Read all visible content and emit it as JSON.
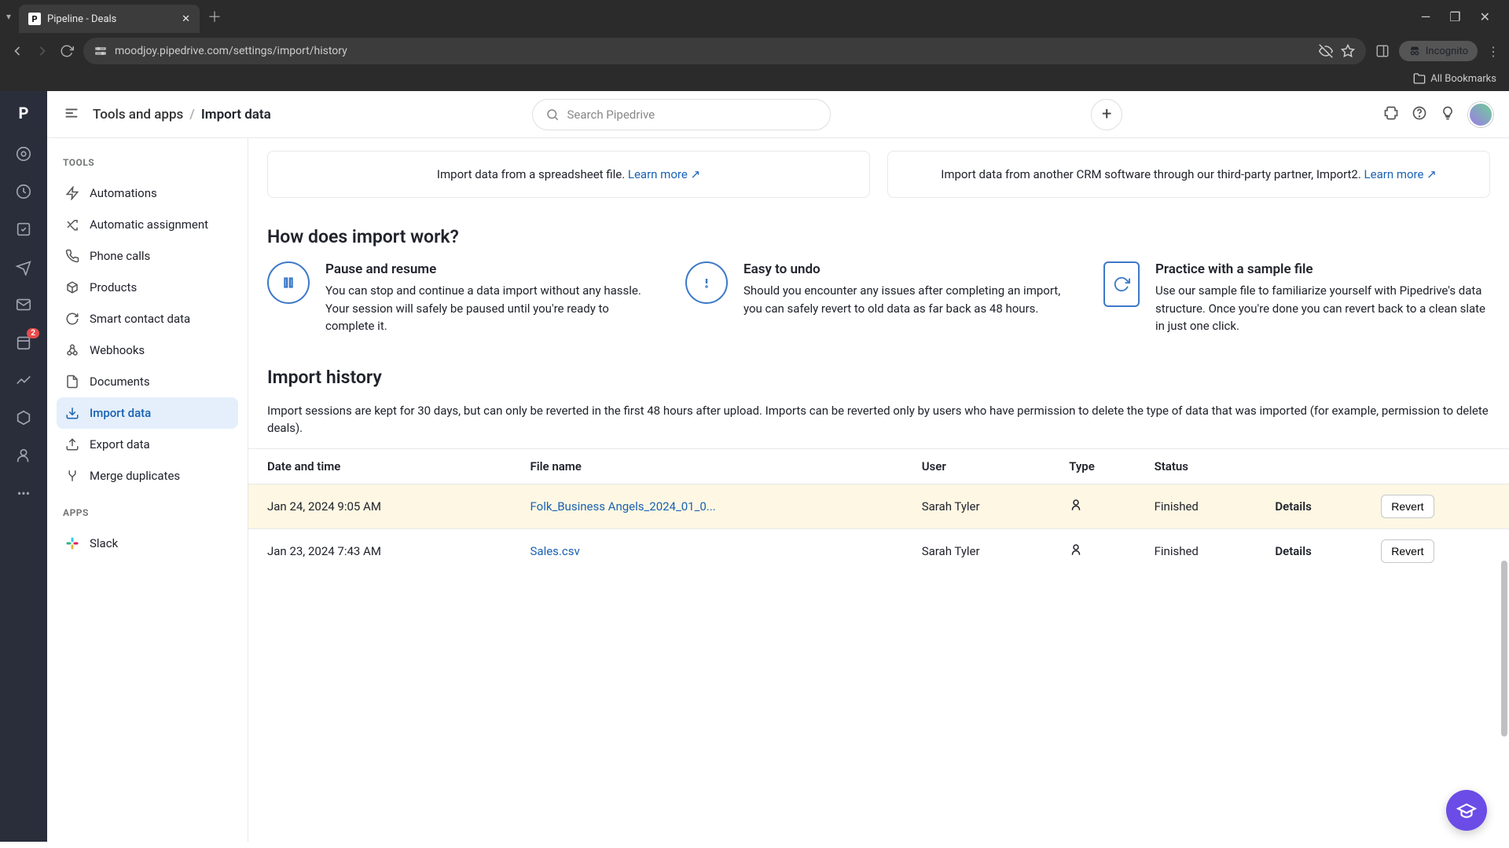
{
  "browser": {
    "tab_title": "Pipeline - Deals",
    "url": "moodjoy.pipedrive.com/settings/import/history",
    "incognito": "Incognito",
    "all_bookmarks": "All Bookmarks"
  },
  "header": {
    "breadcrumb_root": "Tools and apps",
    "breadcrumb_current": "Import data",
    "search_placeholder": "Search Pipedrive"
  },
  "sidebar": {
    "section_tools": "TOOLS",
    "section_apps": "APPS",
    "items": [
      {
        "label": "Automations"
      },
      {
        "label": "Automatic assignment"
      },
      {
        "label": "Phone calls"
      },
      {
        "label": "Products"
      },
      {
        "label": "Smart contact data"
      },
      {
        "label": "Webhooks"
      },
      {
        "label": "Documents"
      },
      {
        "label": "Import data"
      },
      {
        "label": "Export data"
      },
      {
        "label": "Merge duplicates"
      }
    ],
    "apps": [
      {
        "label": "Slack"
      }
    ]
  },
  "nav_badge": "2",
  "cards": {
    "spreadsheet": {
      "text": "Import data from a spreadsheet file.",
      "link": "Learn more"
    },
    "crm": {
      "text": "Import data from another CRM software through our third-party partner, Import2.",
      "link": "Learn more"
    }
  },
  "section_title": "How does import work?",
  "features": [
    {
      "title": "Pause and resume",
      "desc": "You can stop and continue a data import without any hassle. Your session will safely be paused until you're ready to complete it."
    },
    {
      "title": "Easy to undo",
      "desc": "Should you encounter any issues after completing an import, you can safely revert to old data as far back as 48 hours."
    },
    {
      "title": "Practice with a sample file",
      "desc": "Use our sample file to familiarize yourself with Pipedrive's data structure. Once you're done you can revert back to a clean slate in just one click."
    }
  ],
  "history": {
    "title": "Import history",
    "desc": "Import sessions are kept for 30 days, but can only be reverted in the first 48 hours after upload. Imports can be reverted only by users who have permission to delete the type of data that was imported (for example, permission to delete deals).",
    "columns": {
      "date": "Date and time",
      "file": "File name",
      "user": "User",
      "type": "Type",
      "status": "Status"
    },
    "details_label": "Details",
    "revert_label": "Revert",
    "rows": [
      {
        "date": "Jan 24, 2024 9:05 AM",
        "file": "Folk_Business Angels_2024_01_0...",
        "user": "Sarah Tyler",
        "status": "Finished"
      },
      {
        "date": "Jan 23, 2024 7:43 AM",
        "file": "Sales.csv",
        "user": "Sarah Tyler",
        "status": "Finished"
      }
    ]
  }
}
